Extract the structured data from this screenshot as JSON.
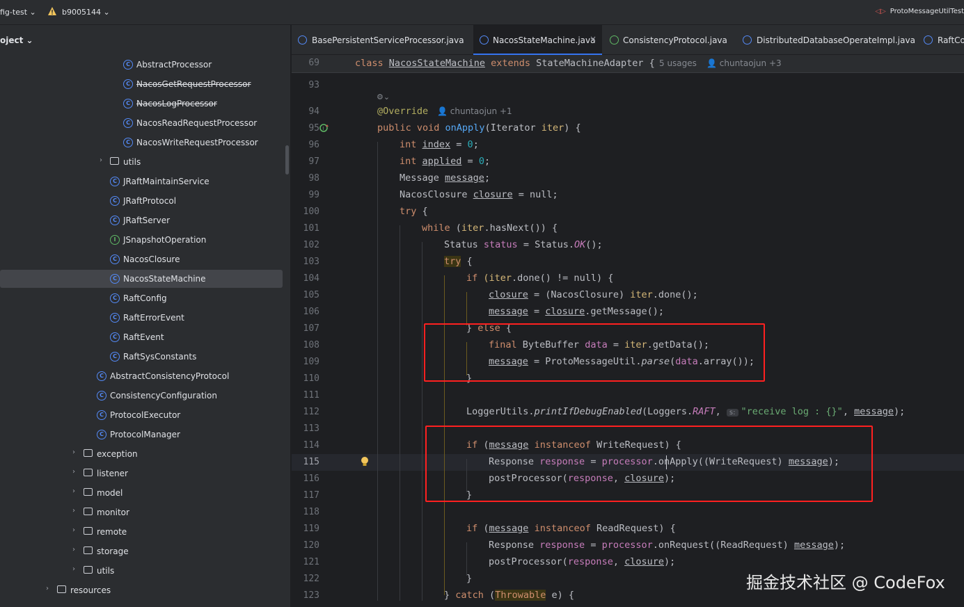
{
  "topbar": {
    "project": "fig-test ⌄",
    "branch": "b9005144 ⌄",
    "right_file": "ProtoMessageUtilTest"
  },
  "panel": {
    "title": "oject ⌄",
    "rows": [
      {
        "label": "AbstractProcessor",
        "kind": "class",
        "strike": false
      },
      {
        "label": "NacosGetRequestProcessor",
        "kind": "class",
        "strike": true
      },
      {
        "label": "NacosLogProcessor",
        "kind": "class",
        "strike": true
      },
      {
        "label": "NacosReadRequestProcessor",
        "kind": "class",
        "strike": false
      },
      {
        "label": "NacosWriteRequestProcessor",
        "kind": "class",
        "strike": false
      },
      {
        "label": "utils",
        "kind": "folder",
        "strike": false
      },
      {
        "label": "JRaftMaintainService",
        "kind": "class",
        "strike": false
      },
      {
        "label": "JRaftProtocol",
        "kind": "class",
        "strike": false
      },
      {
        "label": "JRaftServer",
        "kind": "class",
        "strike": false
      },
      {
        "label": "JSnapshotOperation",
        "kind": "interface",
        "strike": false
      },
      {
        "label": "NacosClosure",
        "kind": "class",
        "strike": false
      },
      {
        "label": "NacosStateMachine",
        "kind": "class",
        "strike": false
      },
      {
        "label": "RaftConfig",
        "kind": "class",
        "strike": false
      },
      {
        "label": "RaftErrorEvent",
        "kind": "class",
        "strike": false
      },
      {
        "label": "RaftEvent",
        "kind": "class",
        "strike": false
      },
      {
        "label": "RaftSysConstants",
        "kind": "class",
        "strike": false
      },
      {
        "label": "AbstractConsistencyProtocol",
        "kind": "class",
        "strike": false
      },
      {
        "label": "ConsistencyConfiguration",
        "kind": "class",
        "strike": false
      },
      {
        "label": "ProtocolExecutor",
        "kind": "class",
        "strike": false
      },
      {
        "label": "ProtocolManager",
        "kind": "class",
        "strike": false
      },
      {
        "label": "exception",
        "kind": "folder",
        "strike": false
      },
      {
        "label": "listener",
        "kind": "folder",
        "strike": false
      },
      {
        "label": "model",
        "kind": "folder",
        "strike": false
      },
      {
        "label": "monitor",
        "kind": "folder",
        "strike": false
      },
      {
        "label": "remote",
        "kind": "folder",
        "strike": false
      },
      {
        "label": "storage",
        "kind": "folder",
        "strike": false
      },
      {
        "label": "utils",
        "kind": "folder",
        "strike": false
      },
      {
        "label": "resources",
        "kind": "folder",
        "strike": false
      }
    ]
  },
  "tabs": [
    {
      "label": "BasePersistentServiceProcessor.java",
      "kind": "class"
    },
    {
      "label": "NacosStateMachine.java",
      "kind": "class",
      "active": true
    },
    {
      "label": "ConsistencyProtocol.java",
      "kind": "interface"
    },
    {
      "label": "DistributedDatabaseOperateImpl.java",
      "kind": "class"
    },
    {
      "label": "RaftCo",
      "kind": "class"
    }
  ],
  "editor": {
    "sticky": {
      "line": "69",
      "code": "class NacosStateMachine extends StateMachineAdapter {",
      "usages": "5 usages",
      "authors": "chuntaojun +3"
    },
    "method_author": "chuntaojun +1",
    "hint_s": "s:",
    "line_numbers": [
      "93",
      "94",
      "95",
      "96",
      "97",
      "98",
      "99",
      "100",
      "101",
      "102",
      "103",
      "104",
      "105",
      "106",
      "107",
      "108",
      "109",
      "110",
      "111",
      "112",
      "113",
      "114",
      "115",
      "116",
      "117",
      "118",
      "119",
      "120",
      "121",
      "122",
      "123"
    ],
    "code": {
      "l94": "@Override",
      "l95_a": "public void ",
      "l95_b": "onApply",
      "l95_c": "(Iterator ",
      "l95_d": "iter",
      "l95_e": ") {",
      "l96_a": "int ",
      "l96_b": "index",
      "l96_c": " = ",
      "l96_d": "0",
      "l96_e": ";",
      "l97_a": "int ",
      "l97_b": "applied",
      "l97_c": " = ",
      "l97_d": "0",
      "l97_e": ";",
      "l98_a": "Message ",
      "l98_b": "message",
      "l98_c": ";",
      "l99_a": "NacosClosure ",
      "l99_b": "closure",
      "l99_c": " = null;",
      "l100_a": "try",
      "l100_b": " {",
      "l101_a": "while ",
      "l101_b": "(",
      "l101_c": "iter",
      "l101_d": ".hasNext()) {",
      "l102_a": "Status ",
      "l102_b": "status",
      "l102_c": " = Status.",
      "l102_d": "OK",
      "l102_e": "();",
      "l103_a": "try",
      "l103_b": " {",
      "l104_a": "if ",
      "l104_b": "(iter",
      "l104_c": ".done() != null) {",
      "l105_a": "closure",
      "l105_b": " = (NacosClosure) ",
      "l105_c": "iter",
      "l105_d": ".done();",
      "l106_a": "message",
      "l106_b": " = ",
      "l106_c": "closure",
      "l106_d": ".getMessage();",
      "l107_a": "} ",
      "l107_b": "else",
      "l107_c": " {",
      "l108_a": "final ",
      "l108_b": "ByteBuffer ",
      "l108_c": "data",
      "l108_d": " = ",
      "l108_e": "iter",
      "l108_f": ".getData();",
      "l109_a": "message",
      "l109_b": " = ProtoMessageUtil.",
      "l109_c": "parse",
      "l109_d": "(",
      "l109_e": "data",
      "l109_f": ".array());",
      "l110": "}",
      "l112_a": "LoggerUtils.",
      "l112_b": "printIfDebugEnabled",
      "l112_c": "(Loggers.",
      "l112_d": "RAFT",
      "l112_e": ", ",
      "l112_f": "\"receive log : {}\"",
      "l112_g": ", ",
      "l112_h": "message",
      "l112_i": ");",
      "l114_a": "if ",
      "l114_b": "(",
      "l114_c": "message",
      "l114_d": " instanceof ",
      "l114_e": "WriteRequest) {",
      "l115_a": "Response ",
      "l115_b": "response",
      "l115_c": " = ",
      "l115_d": "processor",
      "l115_e": ".onApply((WriteRequest) ",
      "l115_f": "message",
      "l115_g": ");",
      "l116_a": "postProcessor(",
      "l116_b": "response",
      "l116_c": ", ",
      "l116_d": "closure",
      "l116_e": ");",
      "l117": "}",
      "l119_a": "if ",
      "l119_b": "(",
      "l119_c": "message",
      "l119_d": " instanceof ",
      "l119_e": "ReadRequest) {",
      "l120_a": "Response ",
      "l120_b": "response",
      "l120_c": " = ",
      "l120_d": "processor",
      "l120_e": ".onRequest((ReadRequest) ",
      "l120_f": "message",
      "l120_g": ");",
      "l121_a": "postProcessor(",
      "l121_b": "response",
      "l121_c": ", ",
      "l121_d": "closure",
      "l121_e": ");",
      "l122": "}",
      "l123_a": "} ",
      "l123_b": "catch ",
      "l123_c": "(",
      "l123_d": "Throwable",
      "l123_e": " e) {"
    }
  },
  "watermark": "掘金技术社区 @ CodeFox"
}
